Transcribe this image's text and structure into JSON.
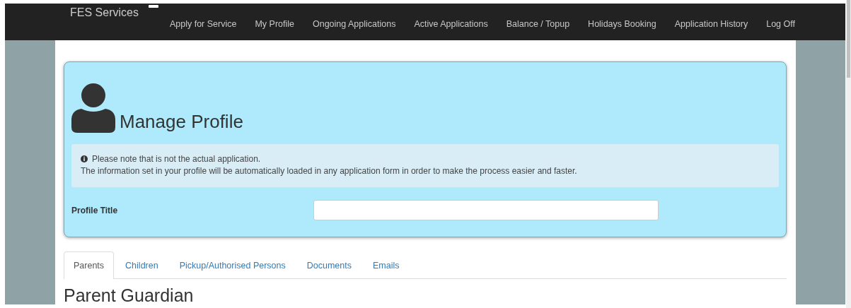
{
  "navbar": {
    "brand": "FES Services",
    "links": [
      "Apply for Service",
      "My Profile",
      "Ongoing Applications",
      "Active Applications",
      "Balance / Topup",
      "Holidays Booking",
      "Application History",
      "Log Off"
    ]
  },
  "panel": {
    "title": "Manage Profile",
    "notice": [
      "Please note that is not the actual application.",
      "The information set in your profile will be automatically loaded in any application form in order to make the process easier and faster."
    ],
    "field": {
      "label": "Profile Title"
    }
  },
  "tabs": [
    {
      "label": "Parents",
      "selected": true
    },
    {
      "label": "Children",
      "selected": false
    },
    {
      "label": "Pickup/Authorised Persons",
      "selected": false
    },
    {
      "label": "Documents",
      "selected": false
    },
    {
      "label": "Emails",
      "selected": false
    }
  ],
  "section_heading": "Parent Guardian"
}
